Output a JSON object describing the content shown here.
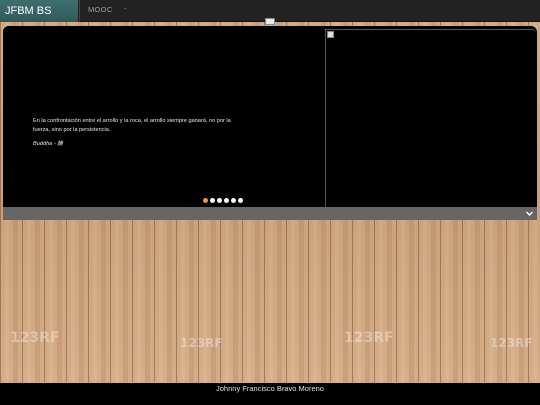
{
  "navbar": {
    "brand": "JFBM BS",
    "items": [
      {
        "label": "MOOC"
      },
      {
        "label": "-"
      }
    ]
  },
  "carousel": {
    "quote": "En la confrontación entre el arrollo y la roca, el arrollo siempre ganará, no por la fuerza, sino por la persistencia.",
    "author": "Buddha - 鎌",
    "slide_count": 6,
    "active_slide": 1
  },
  "footer": {
    "text": "Johnny Francisco Bravo Moreno"
  },
  "watermarks": {
    "brand": "123RF"
  },
  "colors": {
    "navbar_bg": "#222222",
    "brand_bg": "#3f6e6e",
    "active_indicator": "#e89a3c",
    "collapse_bar": "#666666"
  }
}
